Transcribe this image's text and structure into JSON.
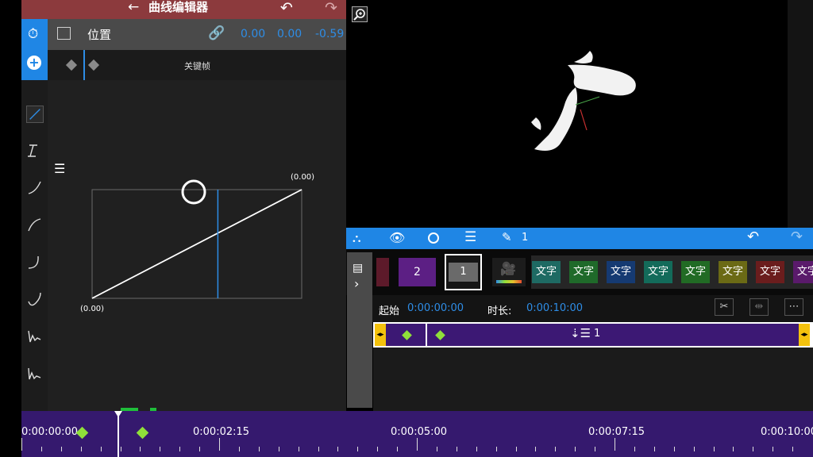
{
  "title_bar": {
    "back_icon": "arrow-left-icon",
    "title": "曲线编辑器",
    "undo_icon": "undo-icon",
    "redo_icon": "redo-icon"
  },
  "property": {
    "label": "位置",
    "values": [
      "0.00",
      "0.00",
      "-0.59"
    ]
  },
  "keyframe_bar": {
    "label": "关键帧"
  },
  "curve": {
    "start_label": "(0.00)",
    "end_label": "(0.00)",
    "playhead_fraction": 0.6
  },
  "toolbar": {
    "layer_count": "1"
  },
  "clips": {
    "numbered": [
      "2",
      "1"
    ],
    "text_clips": [
      {
        "label": "文字",
        "color": "#1e6a63"
      },
      {
        "label": "文字",
        "color": "#1f6a2a"
      },
      {
        "label": "文字",
        "color": "#153a72"
      },
      {
        "label": "文字",
        "color": "#136b5a"
      },
      {
        "label": "文字",
        "color": "#216b24"
      },
      {
        "label": "文字",
        "color": "#6b6a15"
      },
      {
        "label": "文字",
        "color": "#6b1d1d"
      },
      {
        "label": "文字",
        "color": "#5a1a6b"
      }
    ]
  },
  "info": {
    "start_label": "起始",
    "start_value": "0:00:00:00",
    "duration_label": "时长:",
    "duration_value": "0:00:10:00"
  },
  "track": {
    "layer_label": "1"
  },
  "timeline": {
    "labels": [
      "0:00:00:00",
      "0:00:02:15",
      "0:00:05:00",
      "0:00:07:15",
      "0:00:10:00"
    ]
  },
  "colors": {
    "accent": "#1f86e5",
    "title_bar": "#8c3a3d",
    "track": "#3c1874",
    "keyframe": "#8fe03a",
    "handle": "#f4c20d"
  }
}
